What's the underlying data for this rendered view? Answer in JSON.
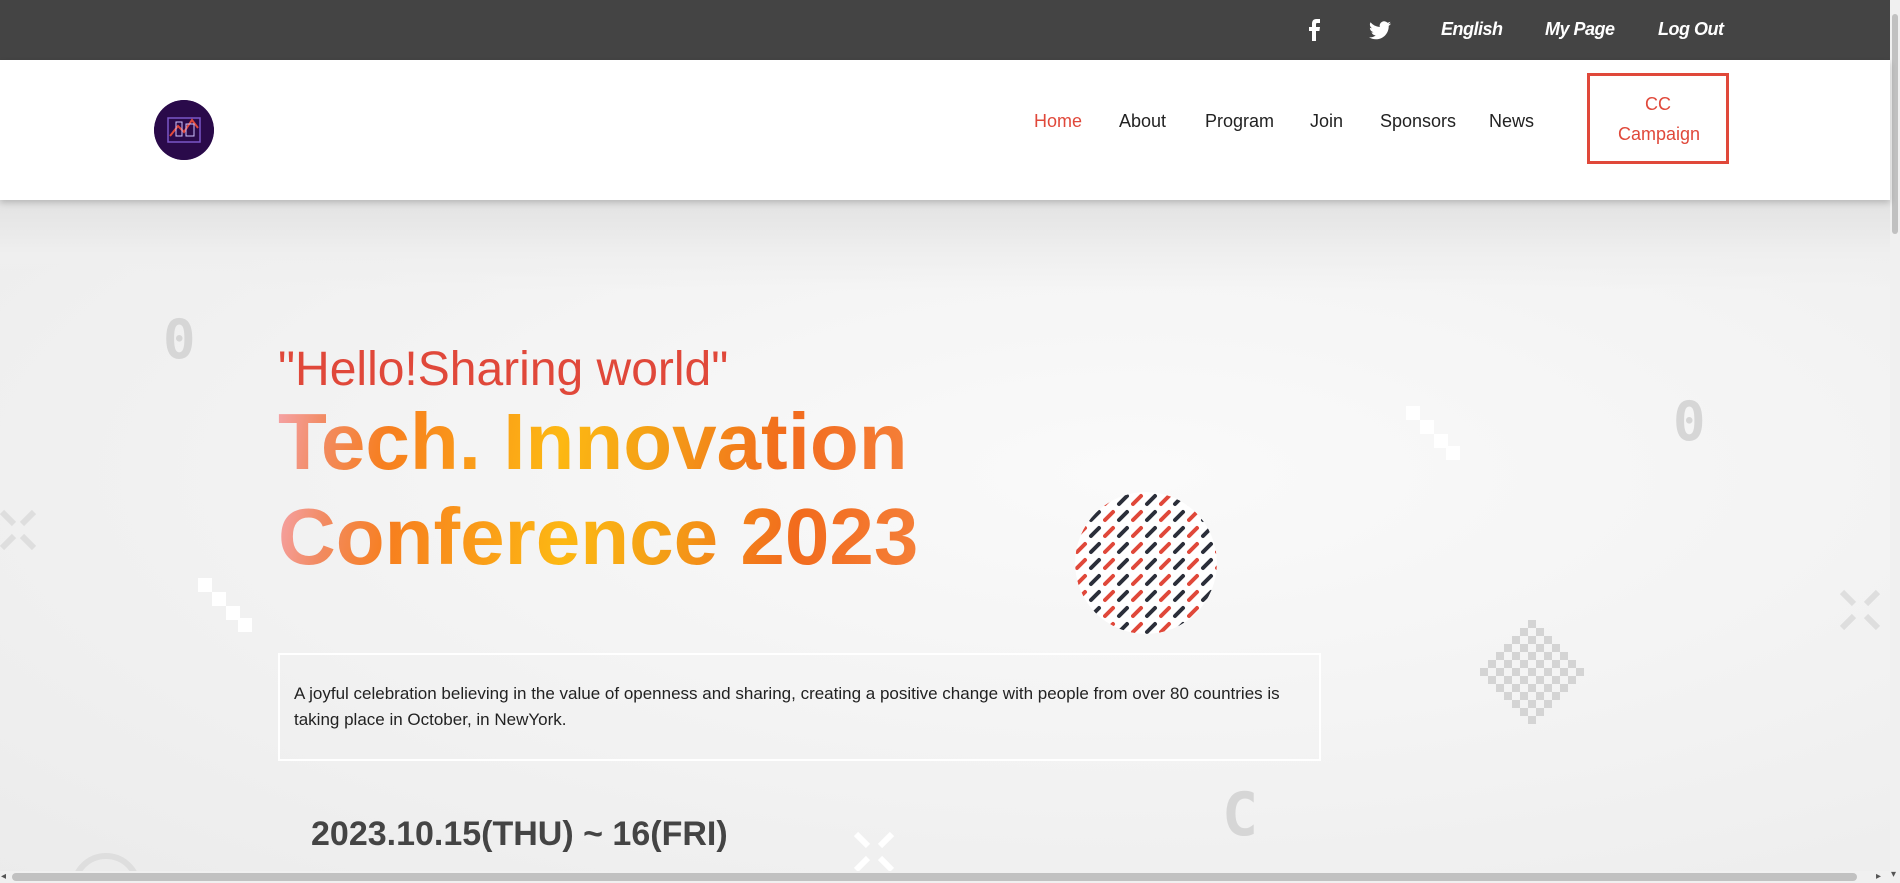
{
  "topbar": {
    "social_icons": [
      "facebook-icon",
      "twitter-icon"
    ],
    "language": "English",
    "my_page": "My Page",
    "log_out": "Log Out"
  },
  "header": {
    "logo": "conference-logo",
    "nav": [
      {
        "label": "Home",
        "active": true
      },
      {
        "label": "About",
        "active": false
      },
      {
        "label": "Program",
        "active": false
      },
      {
        "label": "Join",
        "active": false
      },
      {
        "label": "Sponsors",
        "active": false
      },
      {
        "label": "News",
        "active": false
      }
    ],
    "cta_label": "CC Campaign"
  },
  "hero": {
    "tagline": "\"Hello!Sharing world\"",
    "title_line1": "Tech. Innovation",
    "title_line2": "Conference 2023",
    "description": "A joyful celebration believing in the value of openness and sharing, creating a positive change with people from over 80 countries is taking place in October, in NewYork.",
    "date": "2023.10.15(THU) ~ 16(FRI)"
  },
  "colors": {
    "accent": "#e0483a",
    "topbar_bg": "#444444",
    "title_gradient": [
      "#f5a3a8",
      "#f77f1f",
      "#fdb813",
      "#f26b1d"
    ]
  }
}
